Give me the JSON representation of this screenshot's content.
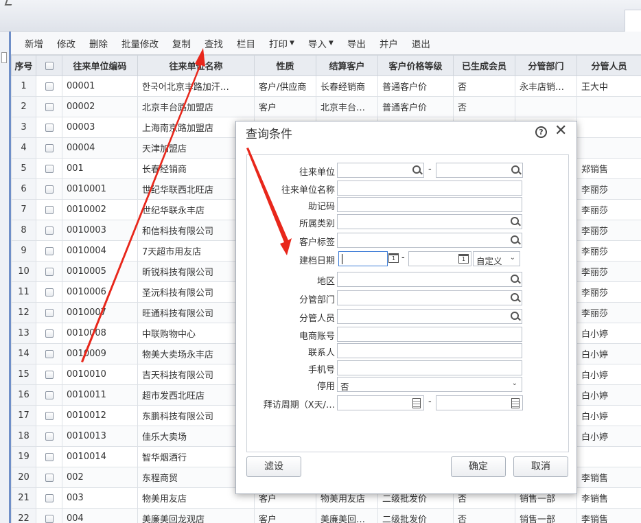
{
  "toolbar": {
    "items": [
      "新增",
      "修改",
      "删除",
      "批量修改",
      "复制",
      "查找",
      "栏目",
      "打印",
      "导入",
      "导出",
      "并户",
      "退出"
    ],
    "dropdown_marker": "⌄"
  },
  "table": {
    "headers": [
      "序号",
      "",
      "往来单位编码",
      "往来单位名称",
      "性质",
      "结算客户",
      "客户价格等级",
      "已生成会员",
      "分管部门",
      "分管人员"
    ],
    "rows": [
      [
        "1",
        "00001",
        "한국어北京丰路加汗…",
        "客户/供应商",
        "长春经销商",
        "普通客户价",
        "否",
        "永丰店销…",
        "王大中"
      ],
      [
        "2",
        "00002",
        "北京丰台路加盟店",
        "客户",
        "北京丰台…",
        "普通客户价",
        "否",
        "",
        ""
      ],
      [
        "3",
        "00003",
        "上海南京路加盟店",
        "",
        "",
        "",
        "",
        "",
        ""
      ],
      [
        "4",
        "00004",
        "天津加盟店",
        "",
        "",
        "",
        "",
        "",
        ""
      ],
      [
        "5",
        "001",
        "长春经销商",
        "",
        "",
        "",
        "",
        "",
        "郑销售"
      ],
      [
        "6",
        "0010001",
        "世纪华联西北旺店",
        "",
        "",
        "",
        "",
        "",
        "李丽莎"
      ],
      [
        "7",
        "0010002",
        "世纪华联永丰店",
        "",
        "",
        "",
        "",
        "",
        "李丽莎"
      ],
      [
        "8",
        "0010003",
        "和信科技有限公司",
        "",
        "",
        "",
        "",
        "",
        "李丽莎"
      ],
      [
        "9",
        "0010004",
        "7天超市用友店",
        "",
        "",
        "",
        "",
        "",
        "李丽莎"
      ],
      [
        "10",
        "0010005",
        "昕锐科技有限公司",
        "",
        "",
        "",
        "",
        "",
        "李丽莎"
      ],
      [
        "11",
        "0010006",
        "圣沅科技有限公司",
        "",
        "",
        "",
        "",
        "",
        "李丽莎"
      ],
      [
        "12",
        "0010007",
        "旺通科技有限公司",
        "",
        "",
        "",
        "",
        "",
        "李丽莎"
      ],
      [
        "13",
        "0010008",
        "中联购物中心",
        "",
        "",
        "",
        "",
        "",
        "白小婷"
      ],
      [
        "14",
        "0010009",
        "物美大卖场永丰店",
        "",
        "",
        "",
        "",
        "",
        "白小婷"
      ],
      [
        "15",
        "0010010",
        "吉天科技有限公司",
        "",
        "",
        "",
        "",
        "",
        "白小婷"
      ],
      [
        "16",
        "0010011",
        "超市发西北旺店",
        "",
        "",
        "",
        "",
        "",
        "白小婷"
      ],
      [
        "17",
        "0010012",
        "东鹏科技有限公司",
        "",
        "",
        "",
        "",
        "",
        "白小婷"
      ],
      [
        "18",
        "0010013",
        "佳乐大卖场",
        "",
        "",
        "",
        "",
        "",
        "白小婷"
      ],
      [
        "19",
        "0010014",
        "智华烟酒行",
        "",
        "",
        "",
        "",
        "",
        ""
      ],
      [
        "20",
        "002",
        "东程商贸",
        "",
        "",
        "",
        "",
        "",
        "李销售"
      ],
      [
        "21",
        "003",
        "物美用友店",
        "客户",
        "物美用友店",
        "二级批发价",
        "否",
        "销售一部",
        "李销售"
      ],
      [
        "22",
        "004",
        "美廉美回龙观店",
        "客户",
        "美廉美回…",
        "二级批发价",
        "否",
        "销售一部",
        "李销售"
      ]
    ]
  },
  "dialog": {
    "title": "查询条件",
    "help": "?",
    "close": "✕",
    "fields": {
      "unit": "往来单位",
      "unit_name": "往来单位名称",
      "mnemonic": "助记码",
      "category": "所属类别",
      "tag": "客户标签",
      "created_date": "建档日期",
      "region": "地区",
      "dept": "分管部门",
      "staff": "分管人员",
      "ecommerce": "电商账号",
      "contact": "联系人",
      "mobile": "手机号",
      "disabled": "停用",
      "visit_cycle": "拜访周期（X天/…"
    },
    "range_dash": "-",
    "date_mode": "自定义",
    "disabled_value": "否",
    "cal_glyph": "1",
    "buttons": {
      "filter": "滤设",
      "ok": "确定",
      "cancel": "取消"
    }
  },
  "colors": {
    "arrow": "#e8271b",
    "header_bg": "#e9ecf1",
    "accent": "#6f8fc8"
  }
}
